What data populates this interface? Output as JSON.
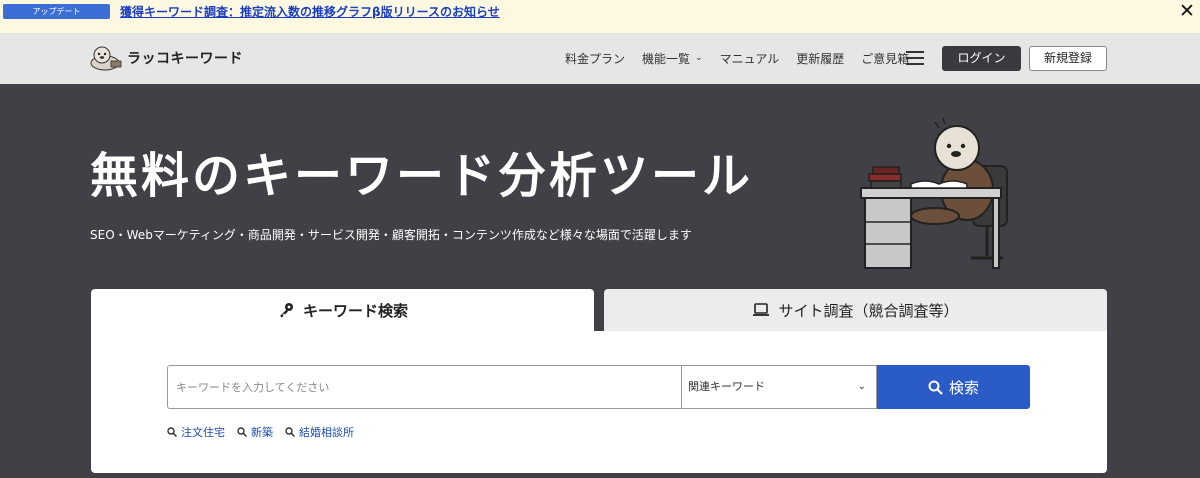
{
  "announcement": {
    "badge": "アップデート",
    "text": "獲得キーワード調査：推定流入数の推移グラフβ版リリースのお知らせ",
    "close": "✕"
  },
  "header": {
    "logo_text": "ラッコキーワード",
    "nav": [
      {
        "label": "料金プラン"
      },
      {
        "label": "機能一覧",
        "chevron": "⌄"
      },
      {
        "label": "マニュアル"
      },
      {
        "label": "更新履歴"
      },
      {
        "label": "ご意見箱"
      }
    ],
    "login": "ログイン",
    "register": "新規登録"
  },
  "hero": {
    "title": "無料のキーワード分析ツール",
    "subtitle": "SEO・Webマーケティング・商品開発・サービス開発・顧客開拓・コンテンツ作成など様々な場面で活躍します"
  },
  "tabs": {
    "keyword": "キーワード検索",
    "site": "サイト調査（競合調査等）"
  },
  "search": {
    "placeholder": "キーワードを入力してください",
    "select_value": "関連キーワード",
    "select_chevron": "⌄",
    "button": "検索",
    "suggestions": [
      "注文住宅",
      "新築",
      "結婚相談所"
    ]
  },
  "colors": {
    "hero_bg": "#404046",
    "accent": "#2a5bc7",
    "badge": "#3b6fd6",
    "announce_bg": "#fdf8e1"
  }
}
